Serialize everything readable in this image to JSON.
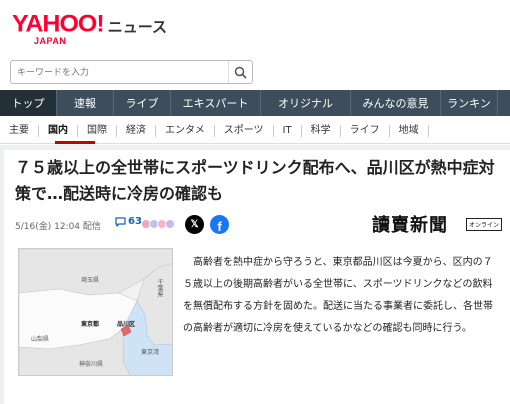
{
  "header": {
    "logo_main": "YAHOO!",
    "logo_sub": "JAPAN",
    "section": "ニュース"
  },
  "search": {
    "placeholder": "キーワードを入力"
  },
  "nav": {
    "items": [
      {
        "label": "トップ"
      },
      {
        "label": "速報"
      },
      {
        "label": "ライブ"
      },
      {
        "label": "エキスパート"
      },
      {
        "label": "オリジナル"
      },
      {
        "label": "みんなの意見"
      },
      {
        "label": "ランキン"
      }
    ]
  },
  "subnav": {
    "items": [
      {
        "label": "主要"
      },
      {
        "label": "国内"
      },
      {
        "label": "国際"
      },
      {
        "label": "経済"
      },
      {
        "label": "エンタメ"
      },
      {
        "label": "スポーツ"
      },
      {
        "label": "IT"
      },
      {
        "label": "科学"
      },
      {
        "label": "ライフ"
      },
      {
        "label": "地域"
      }
    ]
  },
  "article": {
    "title": "７５歳以上の全世帯にスポーツドリンク配布へ、品川区が熱中症対策で…配送時に冷房の確認も",
    "date": "5/16(金) 12:04 配信",
    "comment_count": "63",
    "publisher": "讀賣新聞",
    "publisher_badge": "オンライン",
    "body": "　東京都品川区は今夏か ら、区内の７５歳以上の後期高齢者がいる全世帯に、スポーツドリンクなどの飲料を無償配布する方針を固めた。配送に当たる事業者に委託し、各世帯の高齢者が適切に冷房を使えているかなどの確認も同時に行う。",
    "body_text": "高齢者を熱中症から守ろうと、東京都品川区は今夏から、区内の７５歳以上の後期高齢者がいる全世帯に、スポーツドリンクなどの飲料を無償配布する方針を固めた。配送に当たる事業者に委託し、各世帯の高齢者が適切に冷房を使えているかなどの確認も同時に行う。"
  },
  "map": {
    "labels": {
      "saitama": "埼玉県",
      "chiba": "千葉県",
      "tokyo": "東京都",
      "shinagawa": "品川区",
      "yamanashi": "山梨県",
      "tokyo_bay": "東京湾",
      "kanagawa": "神奈川県"
    }
  },
  "colors": {
    "brand_red": "#ff0033",
    "nav_bg": "#3d4d5c",
    "nav_active": "#243038",
    "accent_red": "#c40000",
    "link_blue": "#1a5fb4",
    "facebook_blue": "#1877f2"
  }
}
